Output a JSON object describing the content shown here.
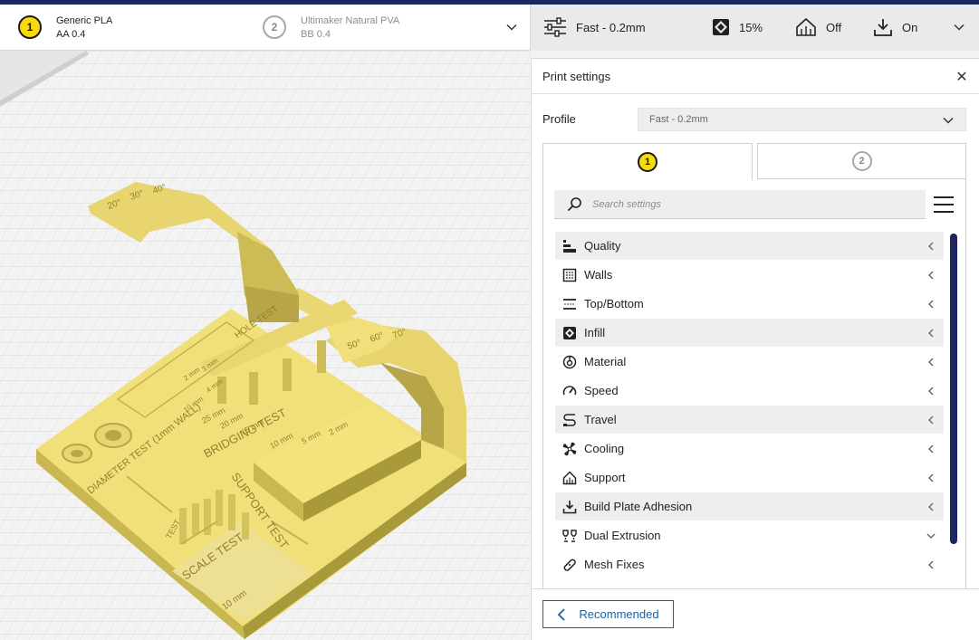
{
  "extruders": [
    {
      "number": "1",
      "material": "Generic PLA",
      "nozzle": "AA 0.4",
      "active": true
    },
    {
      "number": "2",
      "material": "Ultimaker Natural PVA",
      "nozzle": "BB 0.4",
      "active": false
    }
  ],
  "header": {
    "profile": "Fast - 0.2mm",
    "infill": "15%",
    "support": "Off",
    "adhesion": "On"
  },
  "panel": {
    "title": "Print settings",
    "profile_label": "Profile",
    "profile_value": "Fast - 0.2mm",
    "tabs": [
      "1",
      "2"
    ],
    "search_placeholder": "Search settings",
    "categories": [
      {
        "label": "Quality",
        "icon": "quality-icon",
        "expanded": false
      },
      {
        "label": "Walls",
        "icon": "walls-icon",
        "expanded": false
      },
      {
        "label": "Top/Bottom",
        "icon": "top-bottom-icon",
        "expanded": false
      },
      {
        "label": "Infill",
        "icon": "infill-icon",
        "expanded": false
      },
      {
        "label": "Material",
        "icon": "material-icon",
        "expanded": false
      },
      {
        "label": "Speed",
        "icon": "speed-icon",
        "expanded": false
      },
      {
        "label": "Travel",
        "icon": "travel-icon",
        "expanded": false
      },
      {
        "label": "Cooling",
        "icon": "cooling-icon",
        "expanded": false
      },
      {
        "label": "Support",
        "icon": "support-icon",
        "expanded": false
      },
      {
        "label": "Build Plate Adhesion",
        "icon": "adhesion-icon",
        "expanded": false
      },
      {
        "label": "Dual Extrusion",
        "icon": "dual-extrusion-icon",
        "expanded": true
      },
      {
        "label": "Mesh Fixes",
        "icon": "mesh-fixes-icon",
        "expanded": false
      }
    ],
    "recommended_label": "Recommended"
  },
  "model_labels": {
    "hole_test": "HOLE TEST",
    "bridging_test": "BRIDGING TEST",
    "diameter_test": "DIAMETER TEST (1mm WALL)",
    "support_test": "SUPPORT TEST",
    "scale_test": "SCALE TEST",
    "overhang_test": "TEST",
    "scale_value": "10 mm",
    "bridge_lengths": [
      "2 mm",
      "5 mm",
      "10 mm",
      "15 mm",
      "20 mm",
      "25 mm"
    ],
    "hole_sizes": [
      "2 mm",
      "3 mm",
      "4 mm",
      "10 mm"
    ],
    "overhang_angles": [
      "20°",
      "30°",
      "40°",
      "50°",
      "60°",
      "70°"
    ]
  },
  "colors": {
    "accent_navy": "#1c2660",
    "model_yellow": "#f1e07a",
    "extruder_yellow": "#f6d90f",
    "link_blue": "#1f5fa6"
  }
}
